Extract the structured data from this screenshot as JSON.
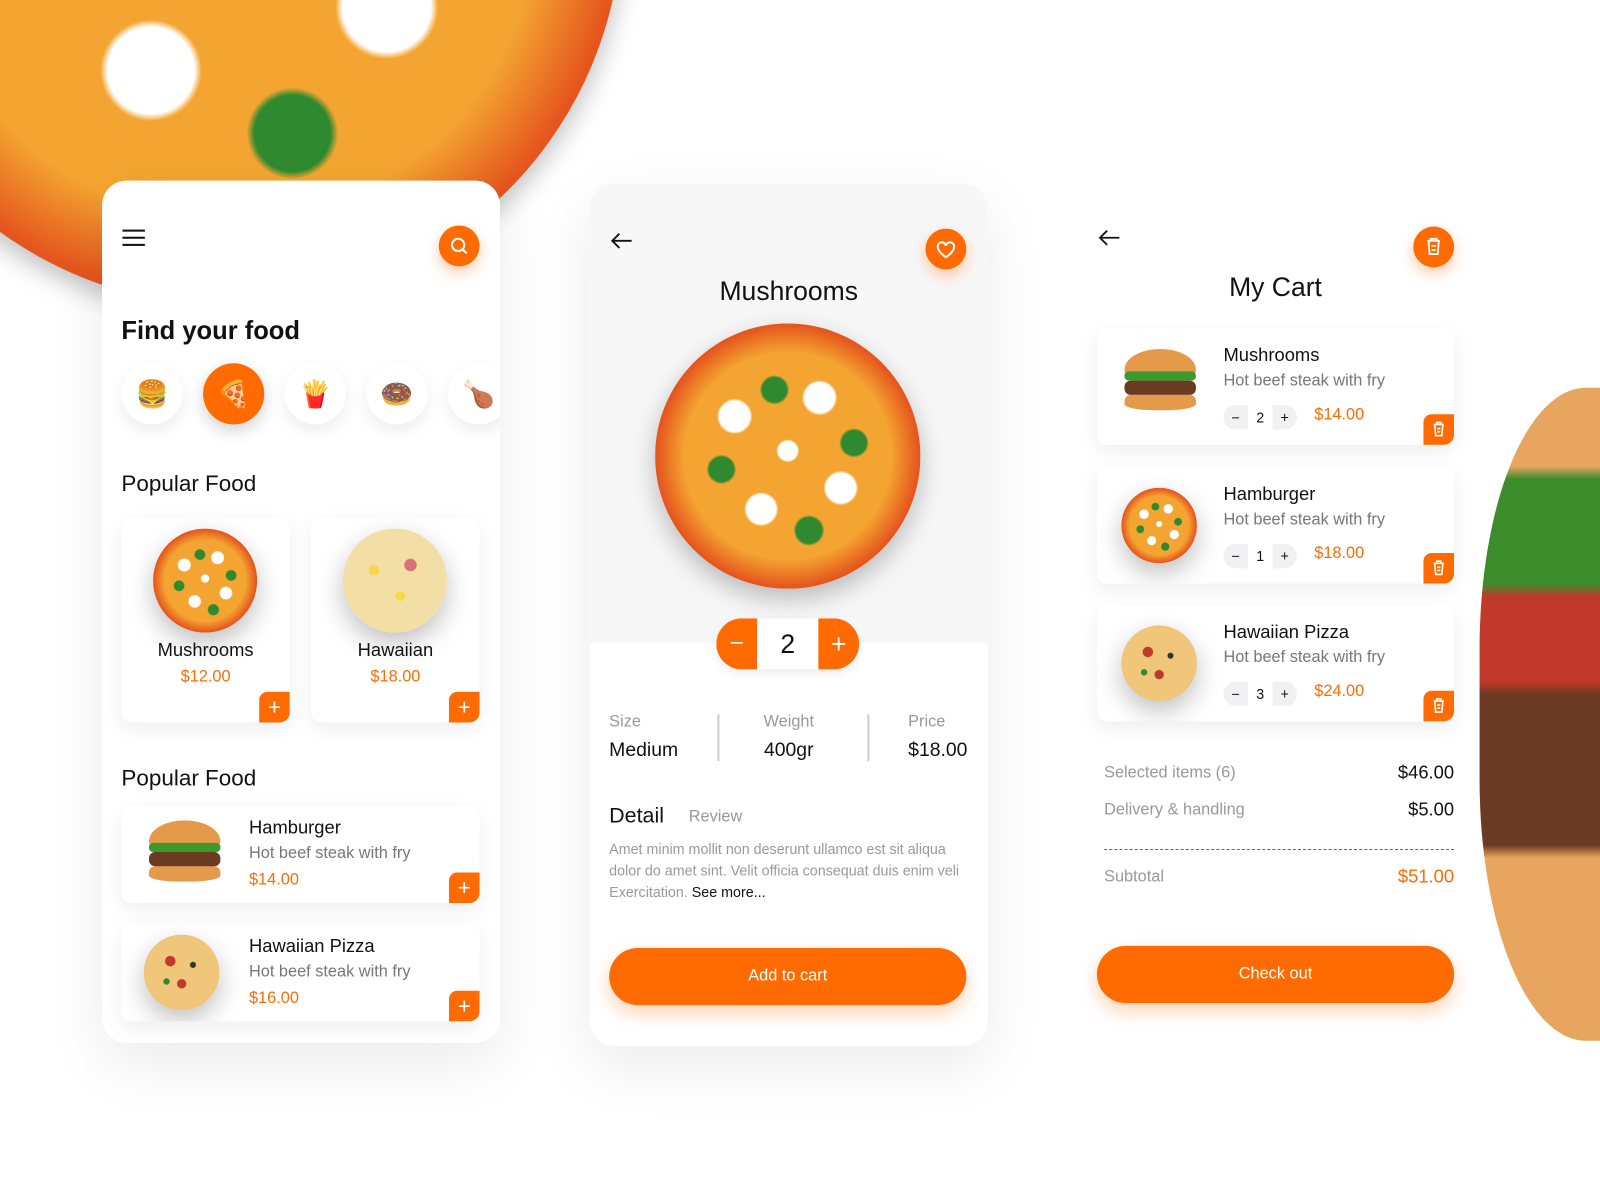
{
  "colors": {
    "accent": "#FF6B00",
    "text": "#111111",
    "muted": "#8a8a8a",
    "panel": "#f7f7f7"
  },
  "home": {
    "menu_icon": "hamburger-menu-icon",
    "search_icon": "search-icon",
    "title": "Find your food",
    "categories": [
      {
        "icon": "burger-icon",
        "active": false
      },
      {
        "icon": "pizza-icon",
        "active": true
      },
      {
        "icon": "fries-icon",
        "active": false
      },
      {
        "icon": "donut-icon",
        "active": false
      },
      {
        "icon": "roast-chicken-icon",
        "active": false
      }
    ],
    "popular_title": "Popular Food",
    "popular": [
      {
        "name": "Mushrooms",
        "price": "$12.00"
      },
      {
        "name": "Hawaiian",
        "price": "$18.00"
      }
    ],
    "popular2_title": "Popular Food",
    "list": [
      {
        "name": "Hamburger",
        "desc": "Hot beef steak with fry",
        "price": "$14.00"
      },
      {
        "name": "Hawaiian Pizza",
        "desc": "Hot beef steak with fry",
        "price": "$16.00"
      }
    ],
    "add_label": "+"
  },
  "detail": {
    "title": "Mushrooms",
    "quantity": "2",
    "minus": "−",
    "plus": "+",
    "specs": [
      {
        "label": "Size",
        "value": "Medium"
      },
      {
        "label": "Weight",
        "value": "400gr"
      },
      {
        "label": "Price",
        "value": "$18.00"
      }
    ],
    "tabs": [
      {
        "label": "Detail",
        "active": true
      },
      {
        "label": "Review",
        "active": false
      }
    ],
    "description": "Amet minim mollit non deserunt ullamco est sit aliqua dolor do amet sint. Velit officia consequat duis enim veli Exercitation.",
    "see_more": "See more...",
    "add_to_cart": "Add to cart"
  },
  "cart": {
    "title": "My Cart",
    "items": [
      {
        "name": "Mushrooms",
        "desc": "Hot beef steak with fry",
        "qty": "2",
        "price": "$14.00"
      },
      {
        "name": "Hamburger",
        "desc": "Hot beef steak with fry",
        "qty": "1",
        "price": "$18.00"
      },
      {
        "name": "Hawaiian Pizza",
        "desc": "Hot beef steak with fry",
        "qty": "3",
        "price": "$24.00"
      }
    ],
    "summary": [
      {
        "label": "Selected items (6)",
        "value": "$46.00"
      },
      {
        "label": "Delivery & handling",
        "value": "$5.00"
      }
    ],
    "subtotal_label": "Subtotal",
    "subtotal_value": "$51.00",
    "checkout": "Check out",
    "step_minus": "−",
    "step_plus": "+"
  }
}
